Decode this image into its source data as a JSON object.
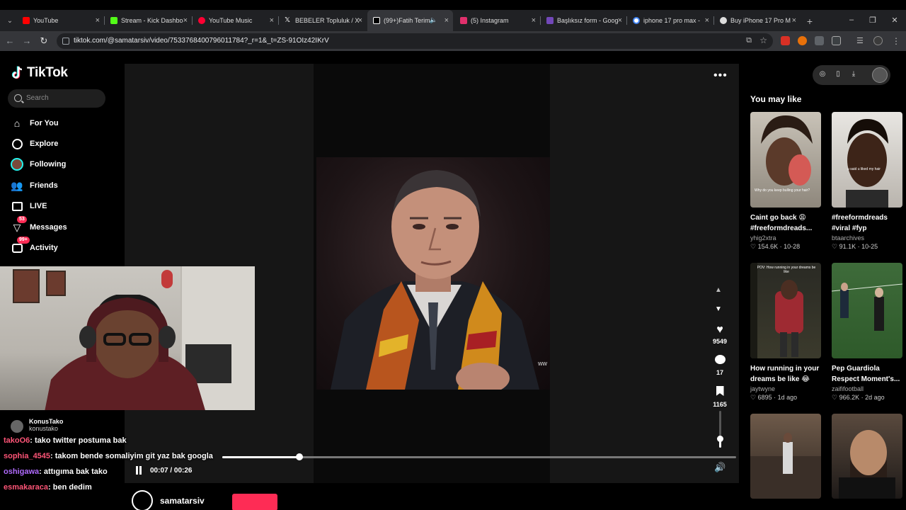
{
  "browser": {
    "tabs": [
      {
        "title": "YouTube",
        "favicon_color": "#ff0000",
        "active": false
      },
      {
        "title": "Stream - Kick Dashbo",
        "favicon_color": "#53fc18",
        "active": false
      },
      {
        "title": "YouTube Music",
        "favicon_color": "#ff0033",
        "active": false
      },
      {
        "title": "BEBELER Topluluk / X",
        "favicon_color": "#ffffff",
        "active": false
      },
      {
        "title": "(99+)Fatih Terim",
        "favicon_color": "#000000",
        "active": true
      },
      {
        "title": "(5) Instagram",
        "favicon_color": "#e1306c",
        "active": false
      },
      {
        "title": "Başlıksız form - Goog",
        "favicon_color": "#7248b9",
        "active": false
      },
      {
        "title": "iphone 17 pro max -",
        "favicon_color": "#4285f4",
        "active": false
      },
      {
        "title": "Buy iPhone 17 Pro M",
        "favicon_color": "#dddddd",
        "active": false
      }
    ],
    "new_tab_label": "+",
    "url": "tiktok.com/@samatarsiv/video/7533768400796011784?_r=1&_t=ZS-91OIz42IKrV"
  },
  "sidebar": {
    "logo_text": "TikTok",
    "search_placeholder": "Search",
    "items": [
      {
        "label": "For You",
        "icon": "home-icon"
      },
      {
        "label": "Explore",
        "icon": "compass-icon"
      },
      {
        "label": "Following",
        "icon": "following-avatar-icon"
      },
      {
        "label": "Friends",
        "icon": "friends-icon"
      },
      {
        "label": "LIVE",
        "icon": "live-icon"
      },
      {
        "label": "Messages",
        "icon": "messages-icon",
        "badge": "53"
      },
      {
        "label": "Activity",
        "icon": "activity-icon",
        "badge": "99+"
      }
    ]
  },
  "player": {
    "likes": "9549",
    "comments": "17",
    "saves": "1165",
    "time": "00:07 / 00:26",
    "progress_fraction": 0.15,
    "volume_fraction": 0.25,
    "author": "samatarsiv",
    "watermark": "ww"
  },
  "overlay": {
    "liker_name": "KonusTako",
    "liker_handle": "konustako",
    "chat": [
      {
        "user": "takoO6",
        "msg": ": tako twitter postuma bak"
      },
      {
        "user": "sophia_4545",
        "msg": ": takom bende somaliyim git yaz bak googla"
      },
      {
        "user": "oshigawa",
        "msg": ": attıgıma bak tako"
      },
      {
        "user": "esmakaraca",
        "msg": ": ben dedim"
      }
    ]
  },
  "rail": {
    "title": "You may like",
    "cards": [
      {
        "title": "Caint go back 😩 #freeformdreads...",
        "author": "yhig2xtra",
        "likes": "154.6K",
        "date": "10-28"
      },
      {
        "title": "#freeformdreads #viral #fyp",
        "author": "btaarchives",
        "likes": "91.1K",
        "date": "10-25"
      },
      {
        "title": "How running in your dreams be like 😂",
        "author": "jaytwyne",
        "likes": "6895",
        "date": "1d ago"
      },
      {
        "title": "Pep Guardiola Respect Moment's...",
        "author": "zaififootball",
        "likes": "966.2K",
        "date": "2d ago"
      },
      {
        "title": "",
        "author": "",
        "likes": "",
        "date": ""
      },
      {
        "title": "",
        "author": "",
        "likes": "",
        "date": ""
      }
    ],
    "thumb_caption_1": "Why do you keep bulling your hair?",
    "thumb_caption_2": "u said u liked my hair",
    "thumb_caption_3": "POV: How running in your dreams be like"
  },
  "colors": {
    "accent": "#fe2c55",
    "background": "#000000",
    "player_bg": "#161616"
  }
}
